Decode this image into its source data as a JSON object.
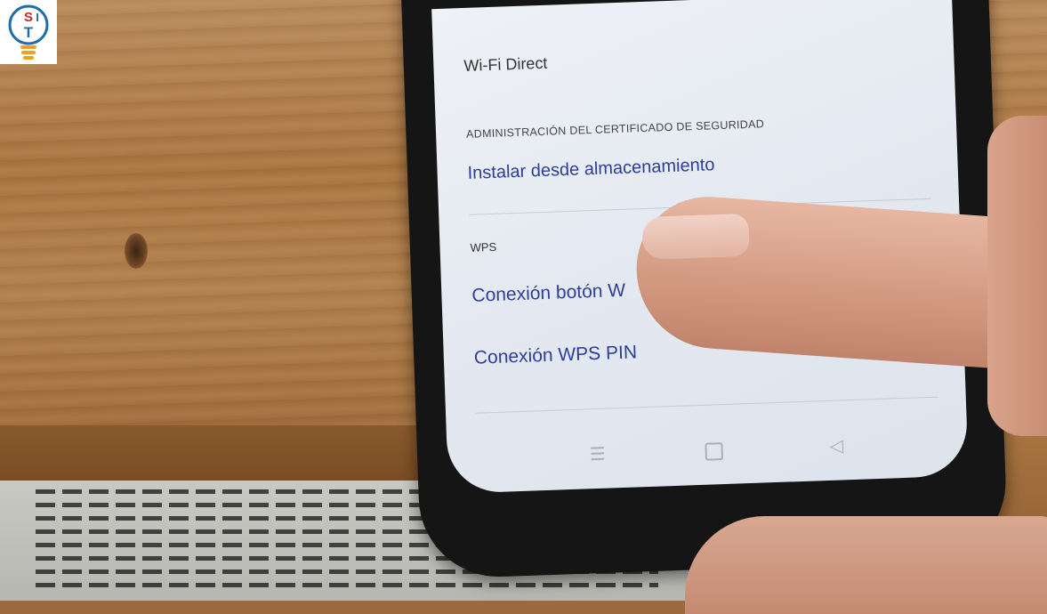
{
  "logo": {
    "text": "SIT"
  },
  "screen": {
    "wifi_direct": "Wi-Fi Direct",
    "cert_section": "ADMINISTRACIÓN DEL CERTIFICADO DE SEGURIDAD",
    "install_storage": "Instalar desde almacenamiento",
    "wps_section": "WPS",
    "wps_button": "Conexión botón W",
    "wps_pin": "Conexión WPS PIN"
  },
  "navbar": {
    "menu_icon": "menu-icon",
    "home_icon": "home-square-icon",
    "back_icon": "back-triangle-icon"
  },
  "colors": {
    "link_blue": "#2d3f9a",
    "screen_bg": "#e4e9f1",
    "wood": "#a87540"
  }
}
